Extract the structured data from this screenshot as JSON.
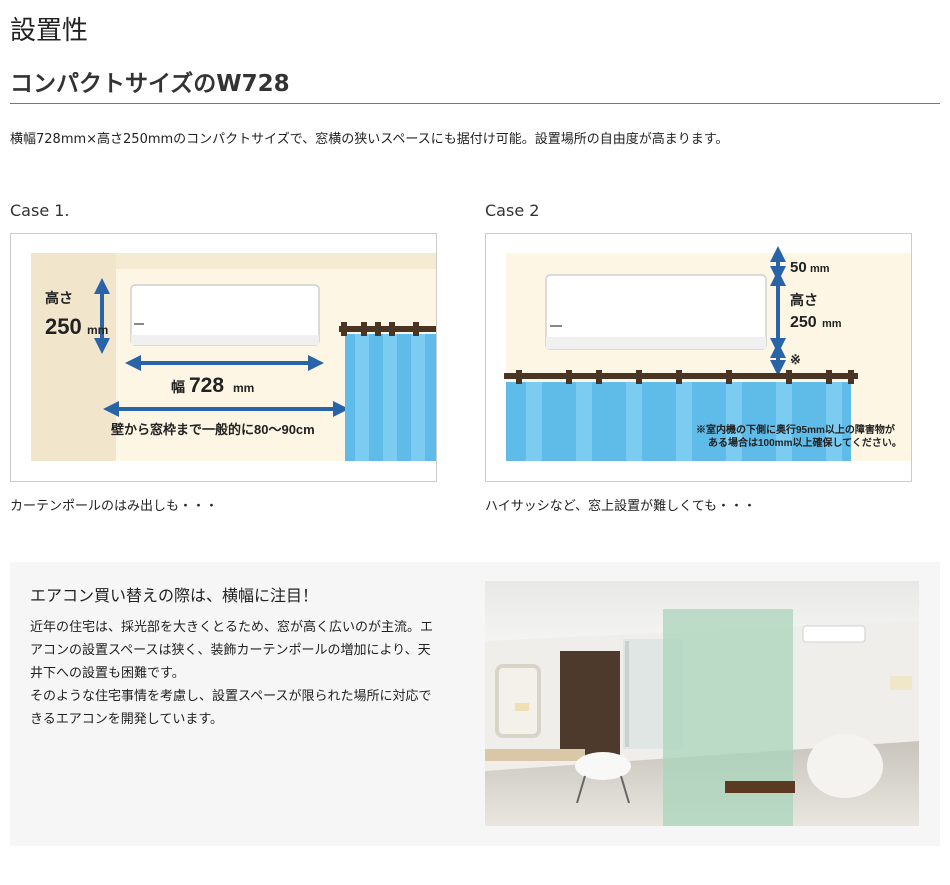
{
  "header": {
    "title": "設置性",
    "subtitle": "コンパクトサイズのW728",
    "lead": "横幅728mm×高さ250mmのコンパクトサイズで、窓横の狭いスペースにも据付け可能。設置場所の自由度が高まります。"
  },
  "case1": {
    "label": "Case 1.",
    "caption": "カーテンポールのはみ出しも・・・",
    "height_label": "高さ",
    "height_value": "250",
    "height_unit": "mm",
    "width_label": "幅",
    "width_value": "728",
    "width_unit": "mm",
    "distance_note": "壁から窓枠まで一般的に80〜90cm"
  },
  "case2": {
    "label": "Case 2",
    "caption": "ハイサッシなど、窓上設置が難しくても・・・",
    "top_value": "50",
    "top_unit": "mm",
    "height_label": "高さ",
    "height_value": "250",
    "height_unit": "mm",
    "mark": "※",
    "note_line1": "※室内機の下側に奥行95mm以上の障害物が",
    "note_line2": "ある場合は100mm以上確保してください。"
  },
  "panel": {
    "heading": "エアコン買い替えの際は、横幅に注目！",
    "body_lines": [
      "近年の住宅は、採光部を大きくとるため、窓が高く広いのが主流。エ",
      "アコンの設置スペースは狭く、装飾カーテンポールの増加により、天",
      "井下への設置も困難です。",
      "そのような住宅事情を考慮し、設置スペースが限られた場所に対応で",
      "きるエアコンを開発しています。"
    ]
  },
  "colors": {
    "accent_blue": "#2a64a8",
    "curtain_blue": "#5fbbe8",
    "wall_cream": "#fdf6e4",
    "wall_shadow": "#f1e6cc",
    "pole_brown": "#4a3524",
    "panel_bg": "#f6f6f6"
  }
}
